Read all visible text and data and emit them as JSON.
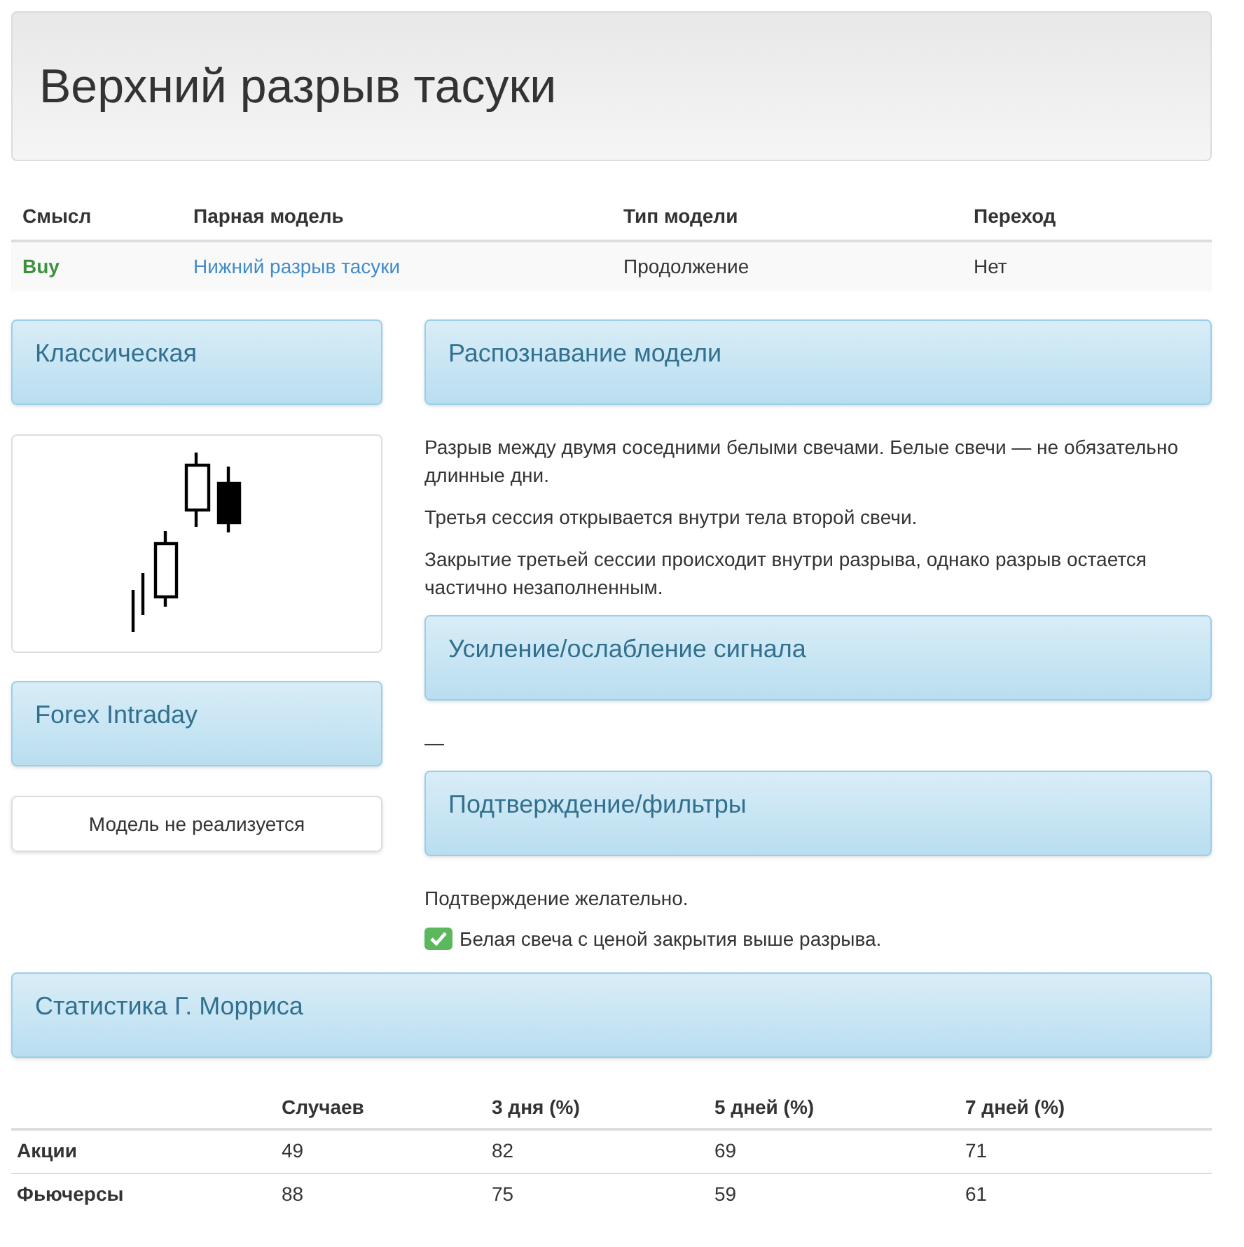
{
  "title": "Верхний разрыв тасуки",
  "summary": {
    "columns": [
      "Смысл",
      "Парная модель",
      "Тип модели",
      "Переход"
    ],
    "row": [
      "Buy",
      "Нижний разрыв тасуки",
      "Продолжение",
      "Нет"
    ]
  },
  "left": [
    {
      "kind": "panel",
      "title": "Классическая"
    },
    {
      "kind": "drawing"
    },
    {
      "kind": "panel",
      "title": "Forex Intraday"
    },
    {
      "kind": "card",
      "text": "Модель не реализуется"
    }
  ],
  "right": [
    {
      "kind": "panel",
      "title": "Распознавание модели"
    },
    {
      "kind": "paragraphs",
      "items": [
        "Разрыв между двумя соседними белыми свечами. Белые свечи — не обязательно длинные дни.",
        "Третья сессия открывается внутри тела второй свечи.",
        "Закрытие третьей сессии происходит внутри разрыва, однако разрыв остается частично незаполненным."
      ]
    },
    {
      "kind": "panel",
      "title": "Усиление/ослабление сигнала"
    },
    {
      "kind": "paragraphs",
      "items": [
        "—"
      ]
    },
    {
      "kind": "panel",
      "title": "Подтверждение/фильтры"
    },
    {
      "kind": "paragraphs",
      "items": [
        "Подтверждение желательно."
      ]
    },
    {
      "kind": "checklist",
      "items": [
        {
          "text": "Белая свеча с ценой закрытия выше разрыва.",
          "checked": true
        }
      ]
    }
  ],
  "stats": {
    "title": "Статистика Г. Морриса",
    "columns": [
      "",
      "Случаев",
      "3 дня (%)",
      "5 дней (%)",
      "7 дней (%)"
    ],
    "rows": [
      [
        "Акции",
        "49",
        "82",
        "69",
        "71"
      ],
      [
        "Фьючерсы",
        "88",
        "75",
        "59",
        "61"
      ]
    ]
  }
}
